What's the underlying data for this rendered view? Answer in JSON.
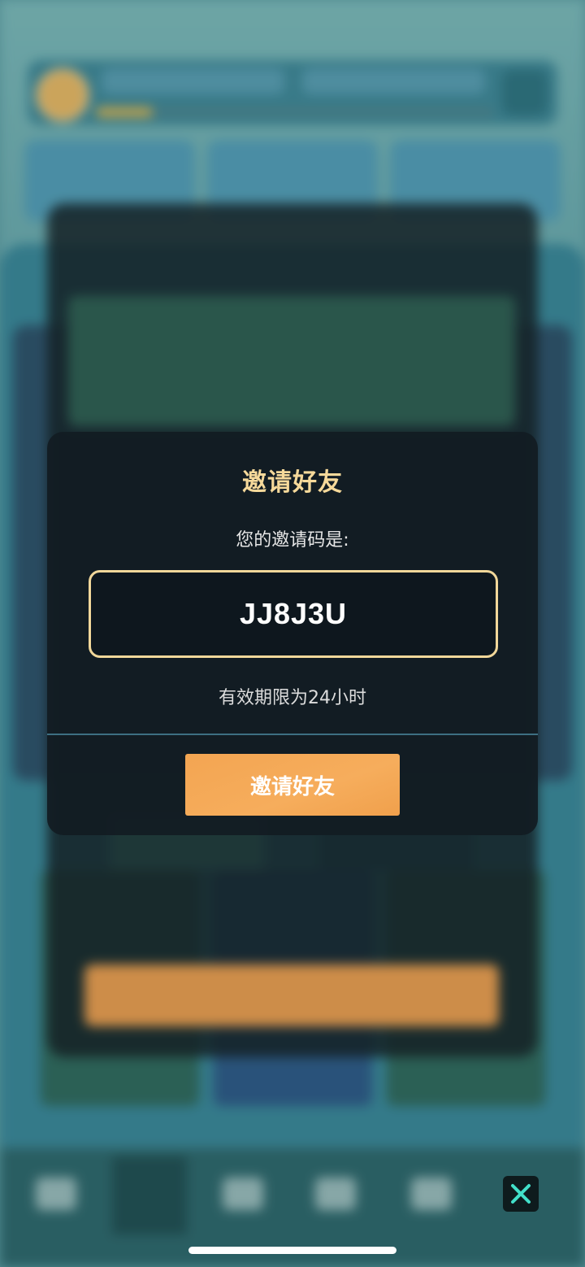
{
  "invite_dialog": {
    "title": "邀请好友",
    "code_label": "您的邀请码是:",
    "invite_code": "JJ8J3U",
    "validity_note": "有效期限为24小时",
    "button_label": "邀请好友"
  },
  "close_button": {
    "icon": "close-icon"
  },
  "colors": {
    "title_gold": "#f6d99a",
    "code_border": "#f1d79a",
    "button_orange": "#f3a552",
    "close_icon_teal": "#42e0c9"
  }
}
